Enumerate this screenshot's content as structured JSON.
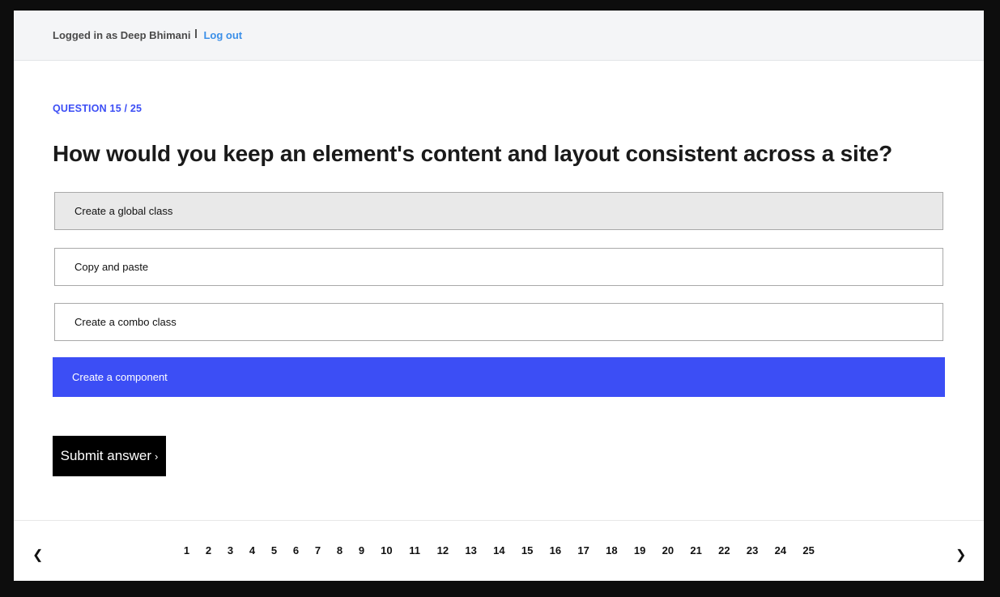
{
  "header": {
    "logged_in_text": "Logged in as Deep Bhimani",
    "logout_label": "Log out"
  },
  "quiz": {
    "question_number": "QUESTION 15 / 25",
    "question_text": "How would you keep an element's content and layout consistent across a site?",
    "options": [
      {
        "label": "Create a global class"
      },
      {
        "label": "Copy and paste"
      },
      {
        "label": "Create a combo class"
      },
      {
        "label": "Create a component"
      }
    ],
    "selected_option_index": 3,
    "submit_label": "Submit answer",
    "submit_icon": "›"
  },
  "pagination": {
    "prev_icon": "❮",
    "next_icon": "❯",
    "pages": [
      "1",
      "2",
      "3",
      "4",
      "5",
      "6",
      "7",
      "8",
      "9",
      "10",
      "11",
      "12",
      "13",
      "14",
      "15",
      "16",
      "17",
      "18",
      "19",
      "20",
      "21",
      "22",
      "23",
      "24",
      "25"
    ]
  },
  "colors": {
    "accent": "#3c4ef5",
    "link": "#3b8fe8",
    "submit_bg": "#000000"
  }
}
